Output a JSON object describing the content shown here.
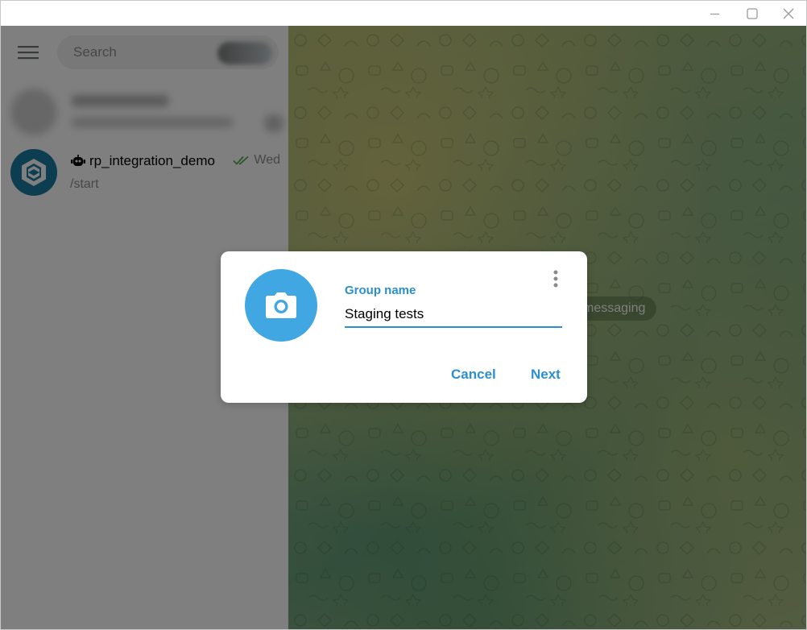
{
  "window": {
    "controls": [
      "minimize-icon",
      "maximize-icon",
      "close-icon"
    ]
  },
  "sidebar": {
    "search": {
      "placeholder": "Search"
    },
    "chats": [
      {
        "title": "rp_integration_demo",
        "time": "Wed",
        "preview": "/start",
        "icon": "bot-icon",
        "status": "read"
      }
    ]
  },
  "chat_area": {
    "service_message": "messaging"
  },
  "dialog": {
    "field_label": "Group name",
    "field_value": "Staging tests",
    "cancel_label": "Cancel",
    "next_label": "Next"
  },
  "colors": {
    "accent": "#2b8fd0",
    "photo_button": "#40a7e3",
    "avatar": "#1b7aa0",
    "read_check": "#4fae4e"
  }
}
